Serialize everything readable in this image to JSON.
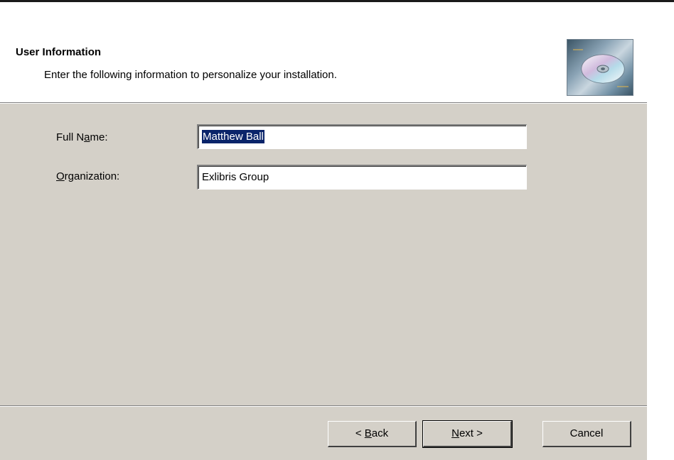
{
  "header": {
    "title": "User Information",
    "subtitle": "Enter the following information to personalize your installation.",
    "icon": "cd-disc-icon"
  },
  "form": {
    "full_name": {
      "label_prefix": "Full N",
      "label_mnemonic": "a",
      "label_suffix": "me:",
      "value": "Matthew Ball"
    },
    "organization": {
      "label_prefix": "",
      "label_mnemonic": "O",
      "label_suffix": "rganization:",
      "value": "Exlibris Group"
    }
  },
  "buttons": {
    "back": {
      "prefix": "< ",
      "mnemonic": "B",
      "suffix": "ack"
    },
    "next": {
      "prefix": "",
      "mnemonic": "N",
      "suffix": "ext >"
    },
    "cancel": {
      "label": "Cancel"
    }
  },
  "colors": {
    "dialog_face": "#d4d0c8",
    "selection": "#0a246a"
  }
}
